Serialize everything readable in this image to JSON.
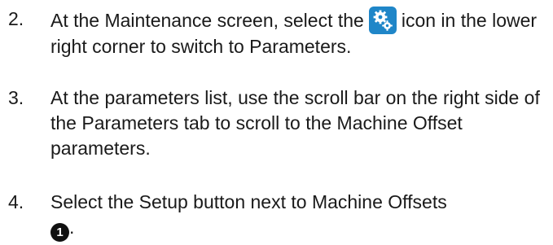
{
  "steps": [
    {
      "number": "2.",
      "text_before_icon": "At the Maintenance screen, select the",
      "icon": "gears-icon",
      "text_after_icon": "icon in the lower right corner to switch to Parameters."
    },
    {
      "number": "3.",
      "text": "At the parameters list, use the scroll bar on the right side of the Parameters tab to scroll to the Machine Offset parameters."
    },
    {
      "number": "4.",
      "text": "Select the Setup button next to Machine Offsets",
      "callout": "1",
      "text_end": "."
    }
  ],
  "colors": {
    "icon_background": "#1f86c8",
    "callout_background": "#111111"
  }
}
